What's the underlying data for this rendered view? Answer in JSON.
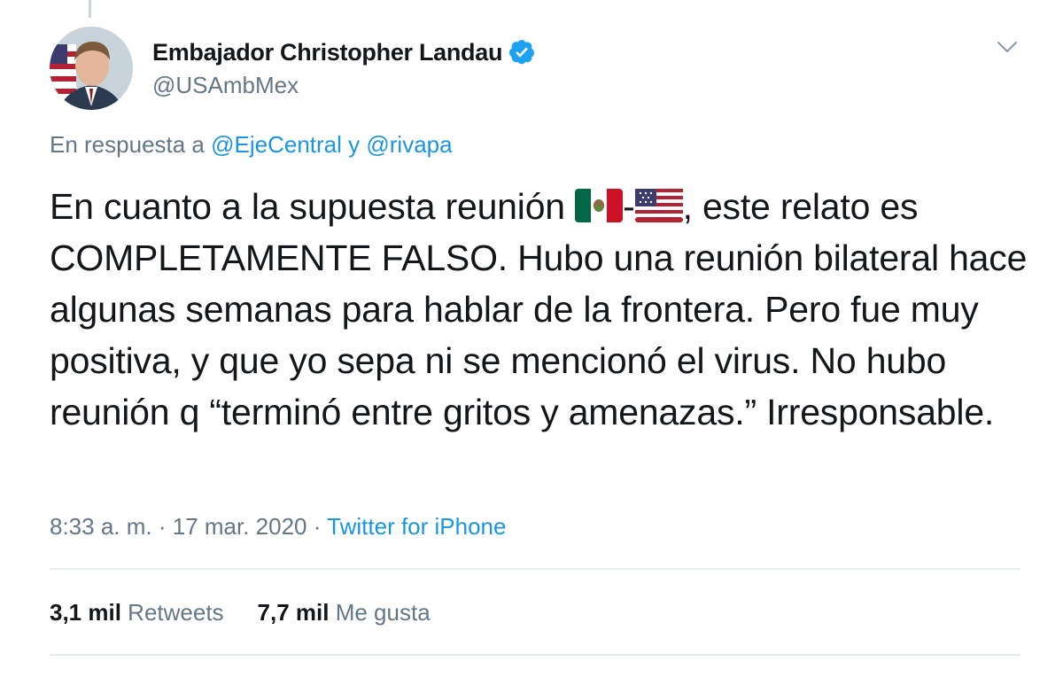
{
  "author": {
    "display_name": "Embajador Christopher Landau",
    "handle": "@USAmbMex",
    "verified": true
  },
  "reply": {
    "prefix": "En respuesta a ",
    "mention_1": "@EjeCentral",
    "conjunction": " y ",
    "mention_2": "@rivapa"
  },
  "tweet": {
    "text_before_flags": "En cuanto a la supuesta reunión ",
    "flag_1": "mexico-flag",
    "flag_separator": "-",
    "flag_2": "usa-flag",
    "text_after_flags": ", este relato es COMPLETAMENTE FALSO. Hubo una reunión bilateral hace algunas semanas para hablar de la frontera. Pero fue muy positiva, y que yo sepa ni se mencionó el virus. No hubo reunión q “terminó entre gritos y amenazas.” Irresponsable."
  },
  "meta": {
    "time": "8:33 a. m.",
    "separator_1": " · ",
    "date": "17 mar. 2020",
    "separator_2": " · ",
    "source": "Twitter for iPhone"
  },
  "stats": {
    "retweets_count": "3,1 mil",
    "retweets_label": " Retweets",
    "likes_count": "7,7 mil",
    "likes_label": " Me gusta"
  },
  "colors": {
    "link": "#1b95e0",
    "secondary_text": "#657786",
    "primary_text": "#14171a",
    "divider": "#e6ecf0"
  }
}
